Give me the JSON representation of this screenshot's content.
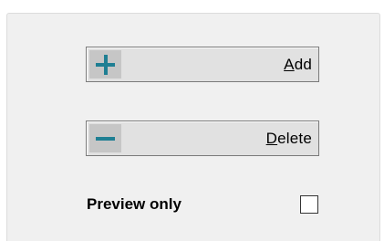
{
  "buttons": {
    "add": {
      "mnemonic": "A",
      "rest": "dd",
      "icon": "plus-icon"
    },
    "delete": {
      "mnemonic": "D",
      "rest": "elete",
      "icon": "minus-icon"
    }
  },
  "preview": {
    "label": "Preview only",
    "checked": false
  },
  "colors": {
    "panel_bg": "#f0f0f0",
    "button_bg": "#e1e1e1",
    "icon_bg": "#c6c6c6",
    "icon_color": "#1f7f93"
  }
}
